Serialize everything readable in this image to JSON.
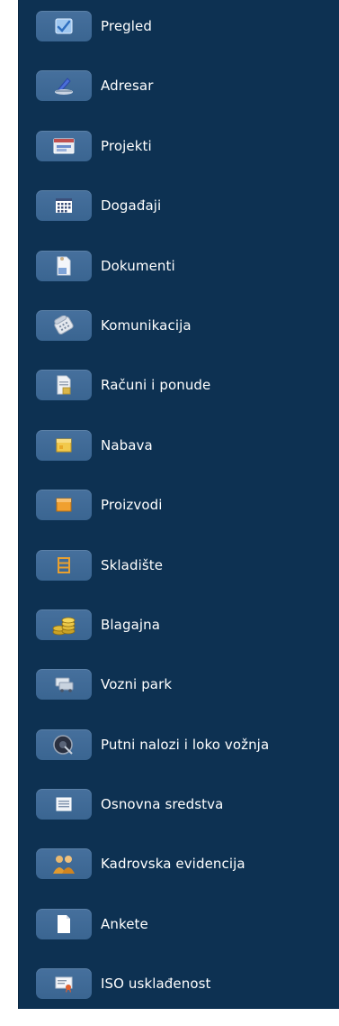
{
  "menu": {
    "items": [
      {
        "label": "Pregled",
        "icon": "overview-icon"
      },
      {
        "label": "Adresar",
        "icon": "address-book-icon"
      },
      {
        "label": "Projekti",
        "icon": "projects-icon"
      },
      {
        "label": "Događaji",
        "icon": "calendar-icon"
      },
      {
        "label": "Dokumenti",
        "icon": "documents-icon"
      },
      {
        "label": "Komunikacija",
        "icon": "phone-icon"
      },
      {
        "label": "Računi i ponude",
        "icon": "invoice-icon"
      },
      {
        "label": "Nabava",
        "icon": "procurement-icon"
      },
      {
        "label": "Proizvodi",
        "icon": "products-icon"
      },
      {
        "label": "Skladište",
        "icon": "warehouse-icon"
      },
      {
        "label": "Blagajna",
        "icon": "coins-icon"
      },
      {
        "label": "Vozni park",
        "icon": "vehicle-icon"
      },
      {
        "label": "Putni nalozi i loko vožnja",
        "icon": "travel-order-icon"
      },
      {
        "label": "Osnovna sredstva",
        "icon": "assets-icon"
      },
      {
        "label": "Kadrovska evidencija",
        "icon": "people-icon"
      },
      {
        "label": "Ankete",
        "icon": "survey-icon"
      },
      {
        "label": "ISO usklađenost",
        "icon": "certificate-icon"
      }
    ]
  }
}
